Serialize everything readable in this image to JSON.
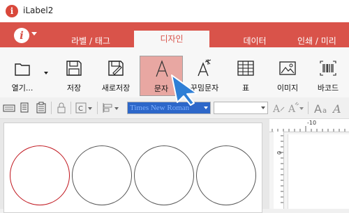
{
  "window": {
    "title": "iLabel2"
  },
  "tabs": [
    {
      "label": "라벨 / 태그"
    },
    {
      "label": "디자인",
      "active": true
    },
    {
      "label": "데이터"
    },
    {
      "label": "인쇄 / 미리"
    }
  ],
  "ribbon": {
    "buttons": [
      {
        "label": "열기...",
        "icon": "folder-icon"
      },
      {
        "label": "저장",
        "icon": "save-icon"
      },
      {
        "label": "새로저장",
        "icon": "save-as-icon"
      },
      {
        "label": "문자",
        "icon": "text-icon",
        "active": true
      },
      {
        "label": "꾸밈문자",
        "icon": "magic-text-icon"
      },
      {
        "label": "표",
        "icon": "table-icon"
      },
      {
        "label": "이미지",
        "icon": "image-icon"
      },
      {
        "label": "바코드",
        "icon": "barcode-icon"
      }
    ]
  },
  "format_toolbar": {
    "font_name": "Times New Roman",
    "font_size": ""
  },
  "ruler": {
    "top_label": "-10",
    "left_label": "0"
  },
  "labels_row": {
    "count": 4,
    "selected_index": 0
  },
  "colors": {
    "accent": "#d9534a",
    "selected_button": "#e8a7a2",
    "selected_shape": "#c0151d"
  }
}
